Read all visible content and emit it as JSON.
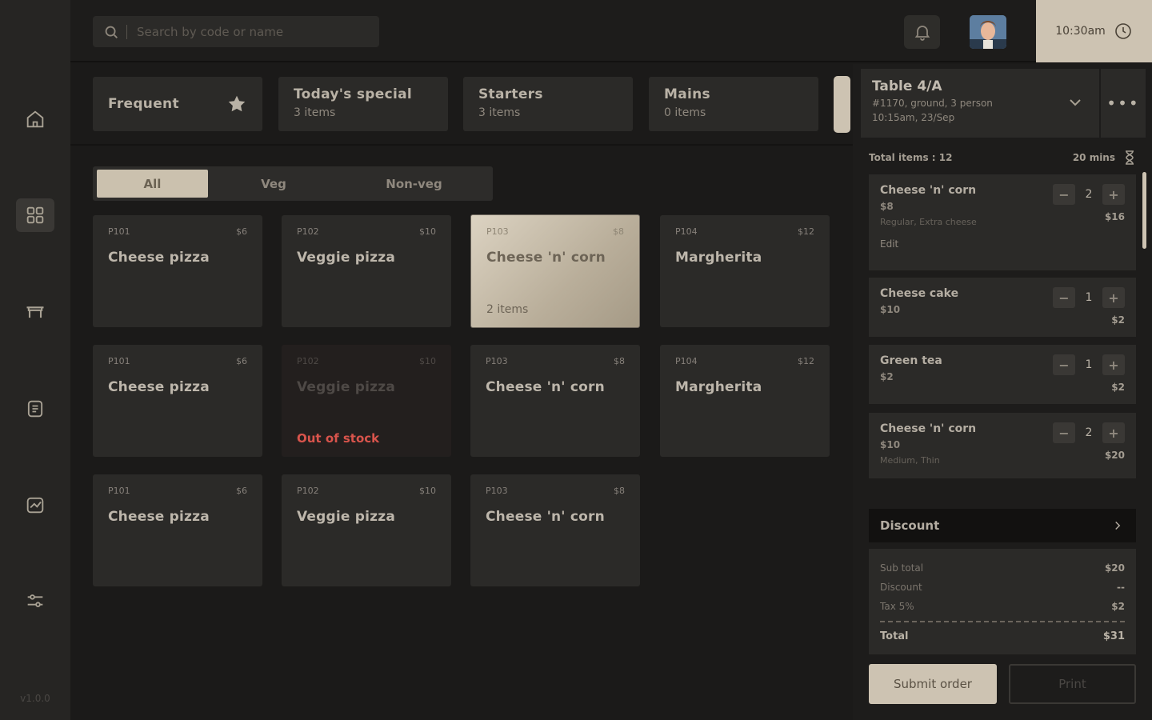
{
  "sidebar": {
    "items": [
      {
        "name": "home-icon"
      },
      {
        "name": "grid-icon"
      },
      {
        "name": "table-icon"
      },
      {
        "name": "receipt-icon"
      },
      {
        "name": "analytics-icon"
      },
      {
        "name": "settings-sliders-icon"
      }
    ],
    "version": "v1.0.0"
  },
  "header": {
    "search_placeholder": "Search by code or name",
    "time": "10:30am"
  },
  "categories": [
    {
      "name": "Frequent",
      "count": ""
    },
    {
      "name": "Today's special",
      "count": "3 items"
    },
    {
      "name": "Starters",
      "count": "3 items"
    },
    {
      "name": "Mains",
      "count": "0 items"
    }
  ],
  "filters": [
    "All",
    "Veg",
    "Non-veg"
  ],
  "menu_items": [
    {
      "code": "P101",
      "price": "$6",
      "name": "Cheese pizza",
      "extra": ""
    },
    {
      "code": "P102",
      "price": "$10",
      "name": "Veggie pizza",
      "extra": ""
    },
    {
      "code": "P103",
      "price": "$8",
      "name": "Cheese 'n' corn",
      "extra": "2 items"
    },
    {
      "code": "P104",
      "price": "$12",
      "name": "Margherita",
      "extra": ""
    },
    {
      "code": "P101",
      "price": "$6",
      "name": "Cheese pizza",
      "extra": ""
    },
    {
      "code": "P102",
      "price": "$10",
      "name": "Veggie pizza",
      "extra": "Out of stock"
    },
    {
      "code": "P103",
      "price": "$8",
      "name": "Cheese 'n' corn",
      "extra": ""
    },
    {
      "code": "P104",
      "price": "$12",
      "name": "Margherita",
      "extra": ""
    },
    {
      "code": "P101",
      "price": "$6",
      "name": "Cheese pizza",
      "extra": ""
    },
    {
      "code": "P102",
      "price": "$10",
      "name": "Veggie pizza",
      "extra": ""
    },
    {
      "code": "P103",
      "price": "$8",
      "name": "Cheese 'n' corn",
      "extra": ""
    }
  ],
  "order": {
    "table": "Table 4/A",
    "details": "#1170, ground, 3 person",
    "datetime": "10:15am, 23/Sep",
    "total_items": "Total items : 12",
    "duration": "20 mins",
    "lines": [
      {
        "name": "Cheese 'n' corn",
        "unit": "$8",
        "note": "Regular, Extra cheese",
        "edit": "Edit",
        "qty": "2",
        "total": "$16"
      },
      {
        "name": "Cheese cake",
        "unit": "$10",
        "note": "",
        "edit": "",
        "qty": "1",
        "total": "$2"
      },
      {
        "name": "Green tea",
        "unit": "$2",
        "note": "",
        "edit": "",
        "qty": "1",
        "total": "$2"
      },
      {
        "name": "Cheese 'n' corn",
        "unit": "$10",
        "note": "Medium, Thin",
        "edit": "",
        "qty": "2",
        "total": "$20"
      }
    ],
    "discount_label": "Discount",
    "summary": {
      "subtotal_label": "Sub total",
      "subtotal": "$20",
      "discount_label": "Discount",
      "discount": "--",
      "tax_label": "Tax 5%",
      "tax": "$2",
      "total_label": "Total",
      "total": "$31"
    },
    "submit_label": "Submit order",
    "print_label": "Print"
  },
  "colors": {
    "accent": "#cdc3b2",
    "background": "#1b1a19",
    "card": "#2b2a28",
    "out_of_stock": "#d9544c"
  }
}
